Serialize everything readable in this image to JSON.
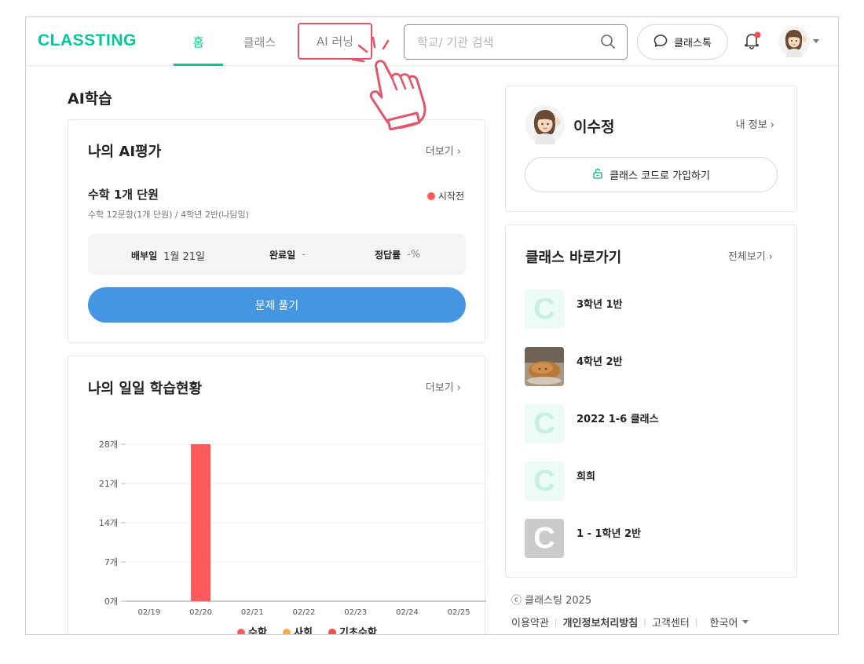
{
  "header": {
    "logo": "CLASSTING",
    "tabs": [
      {
        "label": "홈",
        "active": true
      },
      {
        "label": "클래스",
        "active": false
      },
      {
        "label": "AI 러닝",
        "active": false
      }
    ],
    "search_placeholder": "학교/ 기관 검색",
    "talk_label": "클래스톡",
    "notification_dot": true,
    "brand_color": "#00c896",
    "highlight_color": "#e0566b"
  },
  "main": {
    "section_title": "AI학습",
    "ai_eval": {
      "title": "나의 AI평가",
      "more": "더보기 ›",
      "item_name": "수학 1개 단원",
      "status": "시작전",
      "description": "수학 12문항(1개 단원) / 4학년 2반(나담임)",
      "assigned_label": "배부일",
      "assigned_value": "1월 21일",
      "completed_label": "완료일",
      "completed_value": "-",
      "accuracy_label": "정답률",
      "accuracy_value": "-%",
      "solve_button": "문제 풀기"
    },
    "daily": {
      "title": "나의 일일 학습현황",
      "more": "더보기 ›"
    }
  },
  "chart_data": {
    "type": "bar",
    "categories": [
      "02/19",
      "02/20",
      "02/21",
      "02/22",
      "02/23",
      "02/24",
      "02/25"
    ],
    "series": [
      {
        "name": "수학",
        "color": "#ff5a5a",
        "values": [
          0,
          28,
          0,
          0,
          0,
          0,
          0
        ]
      },
      {
        "name": "사회",
        "color": "#ffa94d",
        "values": [
          0,
          0,
          0,
          0,
          0,
          0,
          0
        ]
      },
      {
        "name": "기초수학",
        "color": "#f5524b",
        "values": [
          0,
          0,
          0,
          0,
          0,
          0,
          0
        ]
      }
    ],
    "yticks": [
      "0개",
      "7개",
      "14개",
      "21개",
      "28개"
    ],
    "ylim": [
      0,
      28
    ],
    "grid": true,
    "legend": "bottom"
  },
  "sidebar": {
    "profile": {
      "name": "이수정",
      "my_info": "내 정보 ›",
      "join_label": "클래스 코드로 가입하기"
    },
    "shortcuts": {
      "title": "클래스 바로가기",
      "more": "전체보기 ›",
      "items": [
        {
          "name": "3학년 1반",
          "thumb": "C",
          "style": "mint"
        },
        {
          "name": "4학년 2반",
          "thumb": "photo",
          "style": "photo"
        },
        {
          "name": "2022 1-6 클래스",
          "thumb": "C",
          "style": "mint"
        },
        {
          "name": "희희",
          "thumb": "C",
          "style": "mint"
        },
        {
          "name": "1 - 1학년 2반",
          "thumb": "C",
          "style": "gray"
        }
      ]
    }
  },
  "footer": {
    "copyright": "ⓒ 클래스팅 2025",
    "links": [
      "이용약관",
      "개인정보처리방침",
      "고객센터"
    ],
    "language": "한국어"
  }
}
